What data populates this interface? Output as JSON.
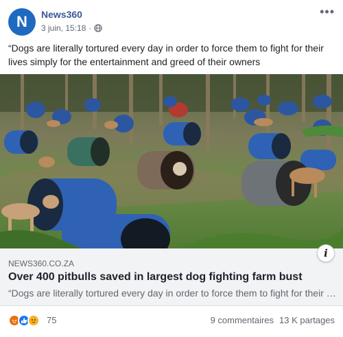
{
  "post": {
    "author": "News360",
    "avatar_letter": "N",
    "timestamp": "3 juin, 15:18",
    "privacy_icon": "globe-icon",
    "more_icon": "more-options-icon",
    "text": "“Dogs are literally tortured every day in order to force them to fight for their lives simply for the entertainment and greed of their owners"
  },
  "link_preview": {
    "domain": "NEWS360.CO.ZA",
    "title": "Over 400 pitbulls saved in largest dog fighting farm bust",
    "description": "“Dogs are literally tortured every day in order to force them to fight for their lives simply for the entertainment and greed of their owners",
    "info_label": "i"
  },
  "footer": {
    "reactions": [
      "angry-icon",
      "like-icon",
      "sad-icon"
    ],
    "reaction_count": "75",
    "comments": "9 commentaires",
    "shares": "13 K partages"
  },
  "colors": {
    "author_blue": "#385898",
    "avatar_bg": "#1f6ac0",
    "link_box_bg": "#f2f3f5"
  }
}
